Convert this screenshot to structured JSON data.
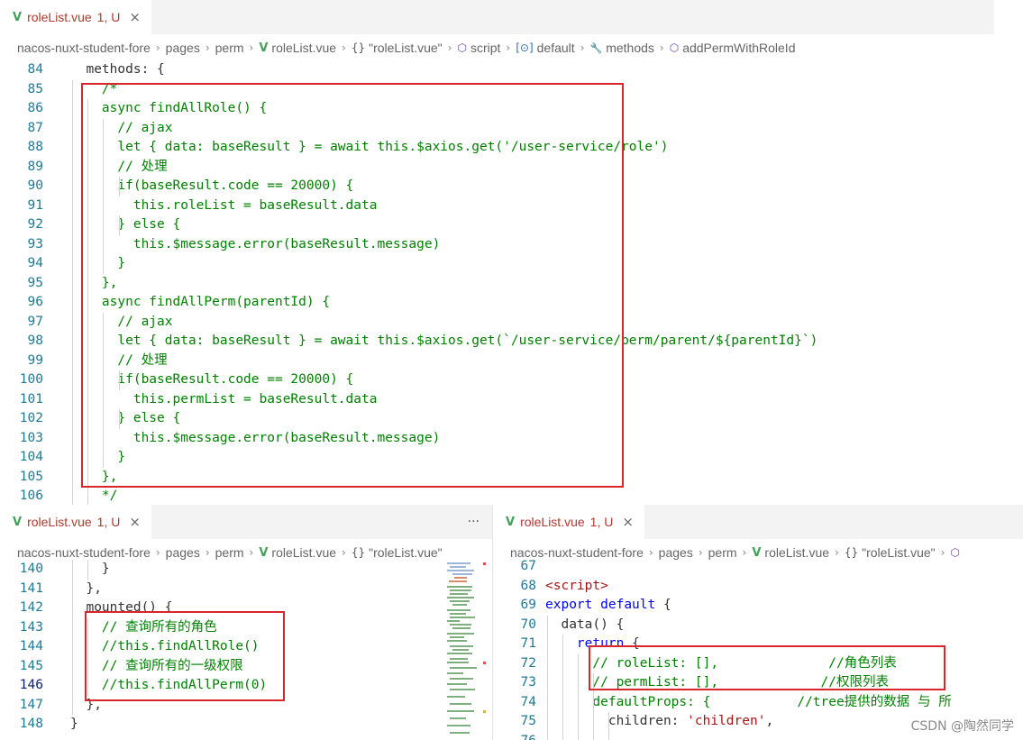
{
  "top_pane": {
    "tab": {
      "vue_icon": "vue-logo-icon",
      "name": "roleList.vue",
      "status": "1, U",
      "close": "×"
    },
    "breadcrumb": [
      {
        "icon": "",
        "label": "nacos-nuxt-student-fore"
      },
      {
        "icon": "",
        "label": "pages"
      },
      {
        "icon": "",
        "label": "perm"
      },
      {
        "icon": "vue",
        "label": "roleList.vue"
      },
      {
        "icon": "{}",
        "label": "\"roleList.vue\""
      },
      {
        "icon": "box",
        "label": "script"
      },
      {
        "icon": "[⊙]",
        "label": "default"
      },
      {
        "icon": "wrench",
        "label": "methods"
      },
      {
        "icon": "box",
        "label": "addPermWithRoleId"
      }
    ],
    "lines": [
      {
        "n": "84",
        "t": "  methods: {"
      },
      {
        "n": "85",
        "t": "    /*"
      },
      {
        "n": "86",
        "t": "    async findAllRole() {"
      },
      {
        "n": "87",
        "t": "      // ajax"
      },
      {
        "n": "88",
        "t": "      let { data: baseResult } = await this.$axios.get('/user-service/role')"
      },
      {
        "n": "89",
        "t": "      // 处理"
      },
      {
        "n": "90",
        "t": "      if(baseResult.code == 20000) {"
      },
      {
        "n": "91",
        "t": "        this.roleList = baseResult.data"
      },
      {
        "n": "92",
        "t": "      } else {"
      },
      {
        "n": "93",
        "t": "        this.$message.error(baseResult.message)"
      },
      {
        "n": "94",
        "t": "      }"
      },
      {
        "n": "95",
        "t": "    },"
      },
      {
        "n": "96",
        "t": "    async findAllPerm(parentId) {"
      },
      {
        "n": "97",
        "t": "      // ajax"
      },
      {
        "n": "98",
        "t": "      let { data: baseResult } = await this.$axios.get(`/user-service/perm/parent/${parentId}`)"
      },
      {
        "n": "99",
        "t": "      // 处理"
      },
      {
        "n": "100",
        "t": "      if(baseResult.code == 20000) {"
      },
      {
        "n": "101",
        "t": "        this.permList = baseResult.data"
      },
      {
        "n": "102",
        "t": "      } else {"
      },
      {
        "n": "103",
        "t": "        this.$message.error(baseResult.message)"
      },
      {
        "n": "104",
        "t": "      }"
      },
      {
        "n": "105",
        "t": "    },"
      },
      {
        "n": "106",
        "t": "    */"
      }
    ]
  },
  "bottom_left_pane": {
    "tab": {
      "name": "roleList.vue",
      "status": "1, U",
      "close": "×",
      "more": "···"
    },
    "breadcrumb": [
      {
        "icon": "",
        "label": "nacos-nuxt-student-fore"
      },
      {
        "icon": "",
        "label": "pages"
      },
      {
        "icon": "",
        "label": "perm"
      },
      {
        "icon": "vue",
        "label": "roleList.vue"
      },
      {
        "icon": "{}",
        "label": "\"roleList.vue\""
      }
    ],
    "lines": [
      {
        "n": "140",
        "t": "    }"
      },
      {
        "n": "141",
        "t": "  },"
      },
      {
        "n": "142",
        "t": "  mounted() {"
      },
      {
        "n": "143",
        "t": "    // 查询所有的角色"
      },
      {
        "n": "144",
        "t": "    //this.findAllRole()"
      },
      {
        "n": "145",
        "t": "    // 查询所有的一级权限"
      },
      {
        "n": "146",
        "t": "    //this.findAllPerm(0)",
        "active": true
      },
      {
        "n": "147",
        "t": "  },"
      },
      {
        "n": "148",
        "t": "}"
      }
    ]
  },
  "bottom_right_pane": {
    "tab": {
      "name": "roleList.vue",
      "status": "1, U",
      "close": "×"
    },
    "breadcrumb": [
      {
        "icon": "",
        "label": "nacos-nuxt-student-fore"
      },
      {
        "icon": "",
        "label": "pages"
      },
      {
        "icon": "",
        "label": "perm"
      },
      {
        "icon": "vue",
        "label": "roleList.vue"
      },
      {
        "icon": "{}",
        "label": "\"roleList.vue\""
      },
      {
        "icon": "box",
        "label": ""
      }
    ],
    "lines": [
      {
        "n": "67",
        "t": ""
      },
      {
        "n": "68",
        "t": "<script>"
      },
      {
        "n": "69",
        "t": "export default {"
      },
      {
        "n": "70",
        "t": "  data() {"
      },
      {
        "n": "71",
        "t": "    return {"
      },
      {
        "n": "72",
        "t": "      // roleList: [],              //角色列表"
      },
      {
        "n": "73",
        "t": "      // permList: [],             //权限列表"
      },
      {
        "n": "74",
        "t": "      defaultProps: {           //tree提供的数据 与 所"
      },
      {
        "n": "75",
        "t": "        children: 'children',"
      },
      {
        "n": "76",
        "t": ""
      }
    ]
  },
  "watermark": "CSDN @陶然同学",
  "colors": {
    "highlight_box": "#d9262b",
    "comment": "#008000",
    "keyword": "#0000ff",
    "string": "#a31515",
    "line_number": "#237893"
  }
}
